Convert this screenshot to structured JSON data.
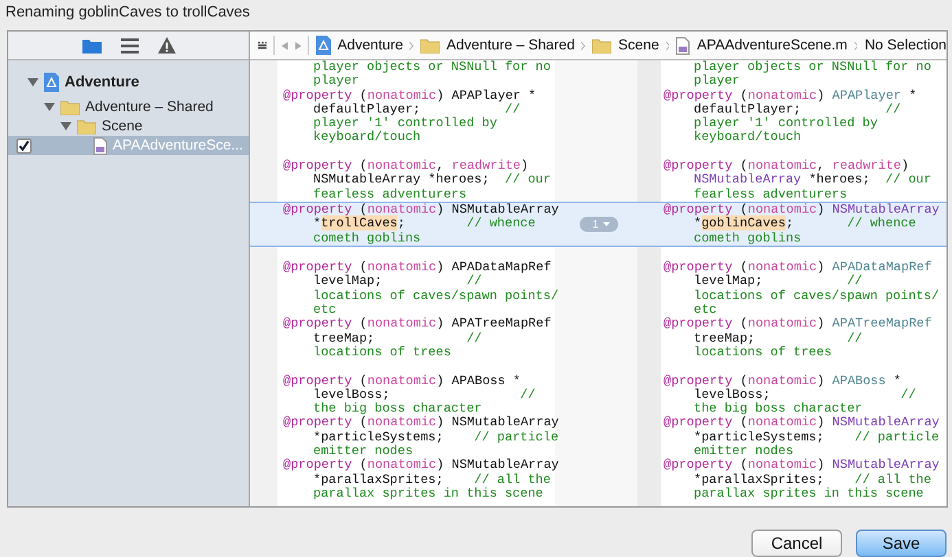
{
  "window": {
    "title": "Renaming goblinCaves to trollCaves"
  },
  "sidebar": {
    "tabs": [
      {
        "kind": "folder",
        "selected": true
      },
      {
        "kind": "list",
        "selected": false
      },
      {
        "kind": "warning",
        "selected": false
      }
    ],
    "tree": [
      {
        "label": "Adventure",
        "kind": "project",
        "expanded": true,
        "children": [
          {
            "label": "Adventure – Shared",
            "kind": "folder",
            "expanded": true,
            "children": [
              {
                "label": "Scene",
                "kind": "folder",
                "expanded": true,
                "children": [
                  {
                    "label": "APAAdventureSce...",
                    "kind": "file",
                    "selected": true,
                    "checked": true
                  }
                ]
              }
            ]
          }
        ]
      }
    ]
  },
  "breadcrumb": [
    {
      "label": "Adventure",
      "kind": "project"
    },
    {
      "label": "Adventure – Shared",
      "kind": "folder"
    },
    {
      "label": "Scene",
      "kind": "folder"
    },
    {
      "label": "APAAdventureScene.m",
      "kind": "file"
    },
    {
      "label": "No Selection",
      "kind": "none"
    }
  ],
  "diff": {
    "blocks": [
      {
        "changed": false,
        "gap_before": false,
        "lines": [
          {
            "wrapped": true,
            "left": [
              {
                "kind": "comment",
                "text": "player objects or NSNull for no"
              }
            ],
            "right": [
              {
                "kind": "comment",
                "text": "player objects or NSNull for no"
              }
            ]
          },
          {
            "wrapped": true,
            "left": [
              {
                "kind": "comment",
                "text": "player"
              }
            ],
            "right": [
              {
                "kind": "comment",
                "text": "player"
              }
            ]
          },
          {
            "wrapped": false,
            "left": [
              {
                "kind": "keyword",
                "text": "@property"
              },
              {
                "kind": "plain",
                "text": " ("
              },
              {
                "kind": "attribute",
                "text": "nonatomic"
              },
              {
                "kind": "plain",
                "text": ") APAPlayer *"
              }
            ],
            "right": [
              {
                "kind": "keyword",
                "text": "@property"
              },
              {
                "kind": "plain",
                "text": " ("
              },
              {
                "kind": "attribute",
                "text": "nonatomic"
              },
              {
                "kind": "plain",
                "text": ") "
              },
              {
                "kind": "class",
                "text": "APAPlayer"
              },
              {
                "kind": "plain",
                "text": " *"
              }
            ]
          },
          {
            "wrapped": true,
            "left": [
              {
                "kind": "plain",
                "text": "defaultPlayer;           "
              },
              {
                "kind": "comment",
                "text": "//"
              }
            ],
            "right": [
              {
                "kind": "plain",
                "text": "defaultPlayer;           "
              },
              {
                "kind": "comment",
                "text": "//"
              }
            ]
          },
          {
            "wrapped": true,
            "left": [
              {
                "kind": "comment",
                "text": "player '1' controlled by"
              }
            ],
            "right": [
              {
                "kind": "comment",
                "text": "player '1' controlled by"
              }
            ]
          },
          {
            "wrapped": true,
            "left": [
              {
                "kind": "comment",
                "text": "keyboard/touch"
              }
            ],
            "right": [
              {
                "kind": "comment",
                "text": "keyboard/touch"
              }
            ]
          }
        ]
      },
      {
        "changed": false,
        "gap_before": true,
        "lines": [
          {
            "wrapped": false,
            "left": [
              {
                "kind": "keyword",
                "text": "@property"
              },
              {
                "kind": "plain",
                "text": " ("
              },
              {
                "kind": "attribute",
                "text": "nonatomic"
              },
              {
                "kind": "plain",
                "text": ", "
              },
              {
                "kind": "attribute",
                "text": "readwrite"
              },
              {
                "kind": "plain",
                "text": ")"
              }
            ],
            "right": [
              {
                "kind": "keyword",
                "text": "@property"
              },
              {
                "kind": "plain",
                "text": " ("
              },
              {
                "kind": "attribute",
                "text": "nonatomic"
              },
              {
                "kind": "plain",
                "text": ", "
              },
              {
                "kind": "attribute",
                "text": "readwrite"
              },
              {
                "kind": "plain",
                "text": ")"
              }
            ]
          },
          {
            "wrapped": true,
            "left": [
              {
                "kind": "plain",
                "text": "NSMutableArray *heroes;  "
              },
              {
                "kind": "comment",
                "text": "// our"
              }
            ],
            "right": [
              {
                "kind": "type",
                "text": "NSMutableArray"
              },
              {
                "kind": "plain",
                "text": " *heroes;  "
              },
              {
                "kind": "comment",
                "text": "// our"
              }
            ]
          },
          {
            "wrapped": true,
            "left": [
              {
                "kind": "comment",
                "text": "fearless adventurers"
              }
            ],
            "right": [
              {
                "kind": "comment",
                "text": "fearless adventurers"
              }
            ]
          }
        ]
      },
      {
        "changed": true,
        "change_label": "1",
        "gap_before": false,
        "lines": [
          {
            "wrapped": false,
            "left": [
              {
                "kind": "keyword",
                "text": "@property"
              },
              {
                "kind": "plain",
                "text": " ("
              },
              {
                "kind": "attribute",
                "text": "nonatomic"
              },
              {
                "kind": "plain",
                "text": ") NSMutableArray"
              }
            ],
            "right": [
              {
                "kind": "keyword",
                "text": "@property"
              },
              {
                "kind": "plain",
                "text": " ("
              },
              {
                "kind": "attribute",
                "text": "nonatomic"
              },
              {
                "kind": "plain",
                "text": ") "
              },
              {
                "kind": "type",
                "text": "NSMutableArray"
              }
            ]
          },
          {
            "wrapped": true,
            "left": [
              {
                "kind": "plain",
                "text": "*"
              },
              {
                "kind": "renamed",
                "text": "trollCaves"
              },
              {
                "kind": "plain",
                "text": ";        "
              },
              {
                "kind": "comment",
                "text": "// whence"
              }
            ],
            "right": [
              {
                "kind": "plain",
                "text": "*"
              },
              {
                "kind": "renamed",
                "text": "goblinCaves"
              },
              {
                "kind": "plain",
                "text": ";       "
              },
              {
                "kind": "comment",
                "text": "// whence"
              }
            ]
          },
          {
            "wrapped": true,
            "left": [
              {
                "kind": "comment",
                "text": "cometh goblins"
              }
            ],
            "right": [
              {
                "kind": "comment",
                "text": "cometh goblins"
              }
            ]
          }
        ]
      },
      {
        "changed": false,
        "gap_before": true,
        "lines": [
          {
            "wrapped": false,
            "left": [
              {
                "kind": "keyword",
                "text": "@property"
              },
              {
                "kind": "plain",
                "text": " ("
              },
              {
                "kind": "attribute",
                "text": "nonatomic"
              },
              {
                "kind": "plain",
                "text": ") APADataMapRef"
              }
            ],
            "right": [
              {
                "kind": "keyword",
                "text": "@property"
              },
              {
                "kind": "plain",
                "text": " ("
              },
              {
                "kind": "attribute",
                "text": "nonatomic"
              },
              {
                "kind": "plain",
                "text": ") "
              },
              {
                "kind": "class",
                "text": "APADataMapRef"
              }
            ]
          },
          {
            "wrapped": true,
            "left": [
              {
                "kind": "plain",
                "text": "levelMap;           "
              },
              {
                "kind": "comment",
                "text": "//"
              }
            ],
            "right": [
              {
                "kind": "plain",
                "text": "levelMap;           "
              },
              {
                "kind": "comment",
                "text": "//"
              }
            ]
          },
          {
            "wrapped": true,
            "left": [
              {
                "kind": "comment",
                "text": "locations of caves/spawn points/"
              }
            ],
            "right": [
              {
                "kind": "comment",
                "text": "locations of caves/spawn points/"
              }
            ]
          },
          {
            "wrapped": true,
            "left": [
              {
                "kind": "comment",
                "text": "etc"
              }
            ],
            "right": [
              {
                "kind": "comment",
                "text": "etc"
              }
            ]
          },
          {
            "wrapped": false,
            "left": [
              {
                "kind": "keyword",
                "text": "@property"
              },
              {
                "kind": "plain",
                "text": " ("
              },
              {
                "kind": "attribute",
                "text": "nonatomic"
              },
              {
                "kind": "plain",
                "text": ") APATreeMapRef"
              }
            ],
            "right": [
              {
                "kind": "keyword",
                "text": "@property"
              },
              {
                "kind": "plain",
                "text": " ("
              },
              {
                "kind": "attribute",
                "text": "nonatomic"
              },
              {
                "kind": "plain",
                "text": ") "
              },
              {
                "kind": "class",
                "text": "APATreeMapRef"
              }
            ]
          },
          {
            "wrapped": true,
            "left": [
              {
                "kind": "plain",
                "text": "treeMap;            "
              },
              {
                "kind": "comment",
                "text": "//"
              }
            ],
            "right": [
              {
                "kind": "plain",
                "text": "treeMap;            "
              },
              {
                "kind": "comment",
                "text": "//"
              }
            ]
          },
          {
            "wrapped": true,
            "left": [
              {
                "kind": "comment",
                "text": "locations of trees"
              }
            ],
            "right": [
              {
                "kind": "comment",
                "text": "locations of trees"
              }
            ]
          }
        ]
      },
      {
        "changed": false,
        "gap_before": true,
        "lines": [
          {
            "wrapped": false,
            "left": [
              {
                "kind": "keyword",
                "text": "@property"
              },
              {
                "kind": "plain",
                "text": " ("
              },
              {
                "kind": "attribute",
                "text": "nonatomic"
              },
              {
                "kind": "plain",
                "text": ") APABoss *"
              }
            ],
            "right": [
              {
                "kind": "keyword",
                "text": "@property"
              },
              {
                "kind": "plain",
                "text": " ("
              },
              {
                "kind": "attribute",
                "text": "nonatomic"
              },
              {
                "kind": "plain",
                "text": ") "
              },
              {
                "kind": "class",
                "text": "APABoss"
              },
              {
                "kind": "plain",
                "text": " *"
              }
            ]
          },
          {
            "wrapped": true,
            "left": [
              {
                "kind": "plain",
                "text": "levelBoss;                 "
              },
              {
                "kind": "comment",
                "text": "//"
              }
            ],
            "right": [
              {
                "kind": "plain",
                "text": "levelBoss;                 "
              },
              {
                "kind": "comment",
                "text": "//"
              }
            ]
          },
          {
            "wrapped": true,
            "left": [
              {
                "kind": "comment",
                "text": "the big boss character"
              }
            ],
            "right": [
              {
                "kind": "comment",
                "text": "the big boss character"
              }
            ]
          },
          {
            "wrapped": false,
            "left": [
              {
                "kind": "keyword",
                "text": "@property"
              },
              {
                "kind": "plain",
                "text": " ("
              },
              {
                "kind": "attribute",
                "text": "nonatomic"
              },
              {
                "kind": "plain",
                "text": ") NSMutableArray"
              }
            ],
            "right": [
              {
                "kind": "keyword",
                "text": "@property"
              },
              {
                "kind": "plain",
                "text": " ("
              },
              {
                "kind": "attribute",
                "text": "nonatomic"
              },
              {
                "kind": "plain",
                "text": ") "
              },
              {
                "kind": "type",
                "text": "NSMutableArray"
              }
            ]
          },
          {
            "wrapped": true,
            "left": [
              {
                "kind": "plain",
                "text": "*particleSystems;    "
              },
              {
                "kind": "comment",
                "text": "// particle"
              }
            ],
            "right": [
              {
                "kind": "plain",
                "text": "*particleSystems;    "
              },
              {
                "kind": "comment",
                "text": "// particle"
              }
            ]
          },
          {
            "wrapped": true,
            "left": [
              {
                "kind": "comment",
                "text": "emitter nodes"
              }
            ],
            "right": [
              {
                "kind": "comment",
                "text": "emitter nodes"
              }
            ]
          },
          {
            "wrapped": false,
            "left": [
              {
                "kind": "keyword",
                "text": "@property"
              },
              {
                "kind": "plain",
                "text": " ("
              },
              {
                "kind": "attribute",
                "text": "nonatomic"
              },
              {
                "kind": "plain",
                "text": ") NSMutableArray"
              }
            ],
            "right": [
              {
                "kind": "keyword",
                "text": "@property"
              },
              {
                "kind": "plain",
                "text": " ("
              },
              {
                "kind": "attribute",
                "text": "nonatomic"
              },
              {
                "kind": "plain",
                "text": ") "
              },
              {
                "kind": "type",
                "text": "NSMutableArray"
              }
            ]
          },
          {
            "wrapped": true,
            "left": [
              {
                "kind": "plain",
                "text": "*parallaxSprites;    "
              },
              {
                "kind": "comment",
                "text": "// all the"
              }
            ],
            "right": [
              {
                "kind": "plain",
                "text": "*parallaxSprites;    "
              },
              {
                "kind": "comment",
                "text": "// all the"
              }
            ]
          },
          {
            "wrapped": true,
            "left": [
              {
                "kind": "comment",
                "text": "parallax sprites in this scene"
              }
            ],
            "right": [
              {
                "kind": "comment",
                "text": "parallax sprites in this scene"
              }
            ]
          }
        ]
      }
    ]
  },
  "buttons": [
    {
      "label": "Cancel",
      "kind": "normal"
    },
    {
      "label": "Save",
      "kind": "default"
    }
  ]
}
